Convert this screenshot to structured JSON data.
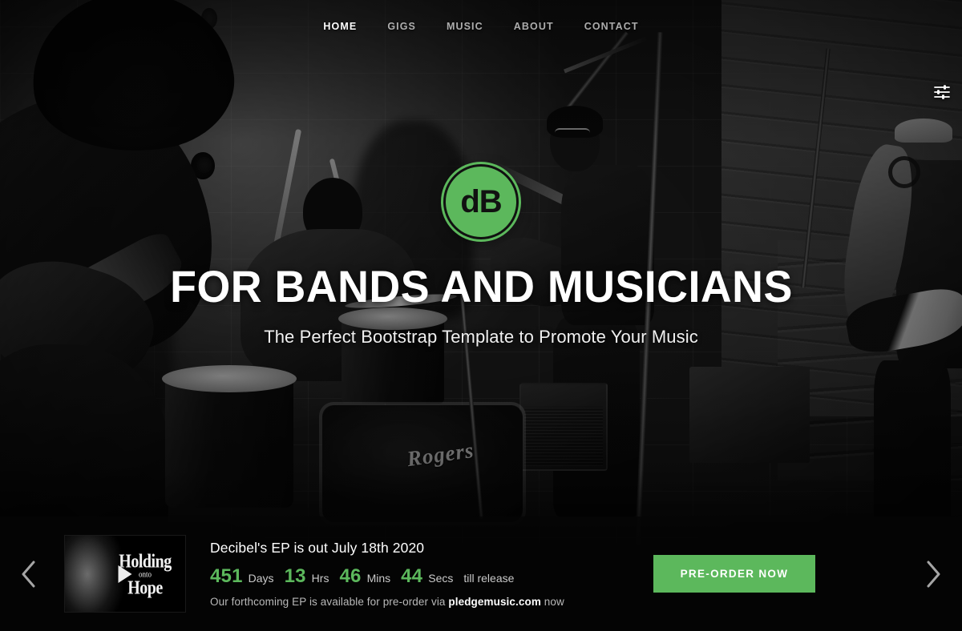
{
  "site": {
    "brand_name": "dB",
    "accent_color": "#5cb85c",
    "dark_color": "#111111"
  },
  "nav": {
    "items": [
      {
        "label": "HOME",
        "active": true
      },
      {
        "label": "GIGS",
        "active": false
      },
      {
        "label": "MUSIC",
        "active": false
      },
      {
        "label": "ABOUT",
        "active": false
      },
      {
        "label": "CONTACT",
        "active": false
      }
    ],
    "settings_icon": "equalizer-sliders-icon"
  },
  "hero": {
    "logo_text": "dB",
    "headline": "FOR BANDS AND MUSICIANS",
    "subheadline": "The Perfect Bootstrap Template to Promote Your Music",
    "background_description": "black-and-white photo of a four-piece band rehearsing in a basement with a Rogers drum kit"
  },
  "release_bar": {
    "prev_arrow_icon": "chevron-left-icon",
    "next_arrow_icon": "chevron-right-icon",
    "album": {
      "title_line1": "Holding",
      "title_line2": "onto",
      "title_line3": "Hope",
      "play_icon": "play-triangle-icon"
    },
    "title": "Decibel's EP is out July 18th 2020",
    "countdown": {
      "units": [
        {
          "value": "451",
          "label": "Days"
        },
        {
          "value": "13",
          "label": "Hrs"
        },
        {
          "value": "46",
          "label": "Mins"
        },
        {
          "value": "44",
          "label": "Secs"
        }
      ],
      "suffix": "till release"
    },
    "subtext_before": "Our forthcoming EP is available for pre-order via",
    "subtext_link": "pledgemusic.com",
    "subtext_after": "now",
    "cta_label": "PRE-ORDER NOW"
  }
}
